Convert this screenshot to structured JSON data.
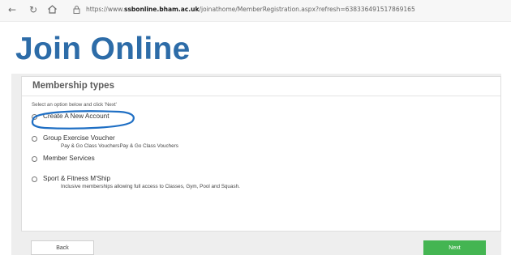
{
  "browser": {
    "url_prefix": "https://www.",
    "url_domain": "ssbonline.bham.ac.uk",
    "url_path": "/joinathome/MemberRegistration.aspx?refresh=638336491517869165"
  },
  "page": {
    "heading": "Join Online"
  },
  "panel": {
    "title": "Membership types",
    "instruction": "Select an option below and click 'Next'",
    "options": [
      {
        "label": "Create A New Account",
        "description": ""
      },
      {
        "label": "Group Exercise Voucher",
        "description": "Pay & Go Class VouchersPay & Go Class Vouchers"
      },
      {
        "label": "Member Services",
        "description": ""
      },
      {
        "label": "Sport & Fitness M'Ship",
        "description": "Inclusive memberships allowing full access to Classes, Gym, Pool and Squash."
      }
    ]
  },
  "footer": {
    "back_label": "Back",
    "next_label": "Next"
  },
  "colors": {
    "heading": "#2d6ca8",
    "next_button": "#44b552",
    "annotation": "#1f6fc4"
  },
  "icons": {
    "back": "arrow-left-icon",
    "reload": "reload-icon",
    "home": "home-icon",
    "lock": "lock-icon"
  }
}
